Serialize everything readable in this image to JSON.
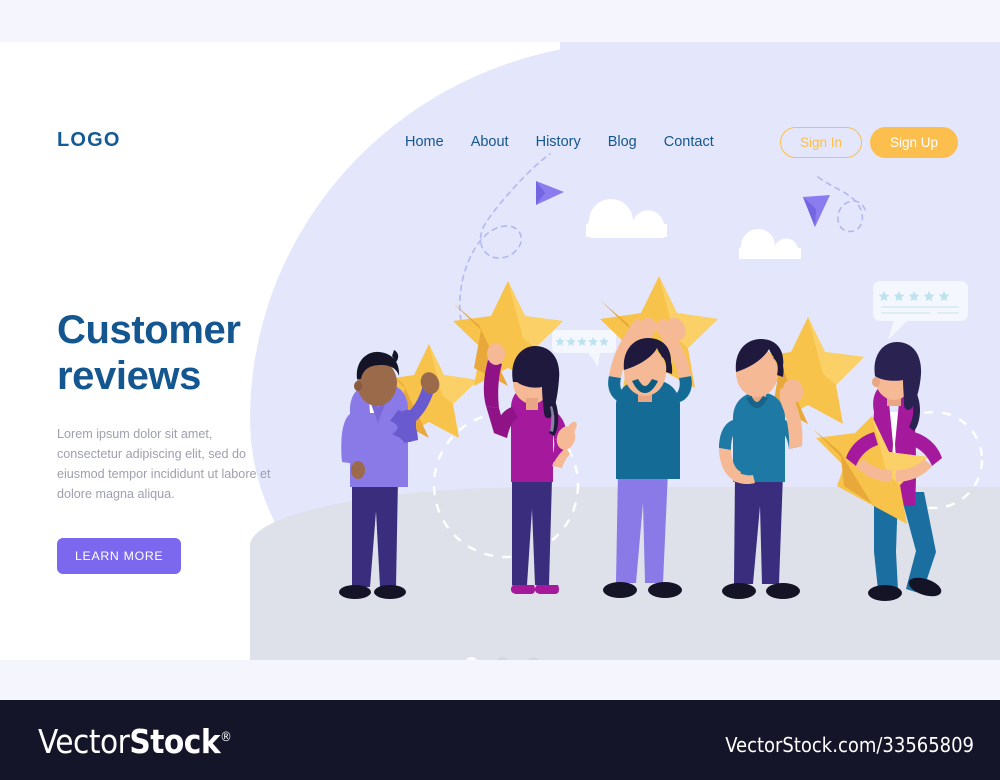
{
  "header": {
    "logo": "LOGO",
    "nav": [
      {
        "label": "Home"
      },
      {
        "label": "About"
      },
      {
        "label": "History"
      },
      {
        "label": "Blog"
      },
      {
        "label": "Contact"
      }
    ],
    "sign_in": "Sign In",
    "sign_up": "Sign Up"
  },
  "hero": {
    "title_line1": "Customer",
    "title_line2": "reviews",
    "subtitle": "Lorem ipsum dolor sit amet, consectetur adipiscing elit, sed do eiusmod tempor incididunt ut labore et dolore magna aliqua.",
    "cta": "LEARN MORE"
  },
  "carousel": {
    "dots": 3,
    "active_index": 0
  },
  "illustration": {
    "people": [
      {
        "name": "man-purple-cardigan",
        "star_count": 1,
        "pose": "holding-star-up"
      },
      {
        "name": "woman-magenta-top",
        "star_count": 1,
        "pose": "raising-star-overhead"
      },
      {
        "name": "man-teal-shirt",
        "star_count": 1,
        "pose": "two-hands-star-overhead"
      },
      {
        "name": "man-blue-tshirt",
        "star_count": 1,
        "pose": "holding-star-side"
      },
      {
        "name": "woman-magenta-coat",
        "star_count": 1,
        "pose": "hugging-star"
      }
    ],
    "review_bubbles": [
      {
        "stars": 5,
        "lines": 0
      },
      {
        "stars": 5,
        "lines": 3
      }
    ],
    "clouds": 2,
    "paper_planes": 2,
    "dashed_circles": 2
  },
  "footer": {
    "brand_thin": "Vector",
    "brand_bold": "Stock",
    "registered": "®",
    "url": "VectorStock.com/33565809"
  },
  "colors": {
    "page_bg": "#f5f5fd",
    "card_bg": "#ffffff",
    "blob": "#e4e7fb",
    "ground": "#dee1ea",
    "brand_blue": "#14568f",
    "accent_yellow": "#fcbf4d",
    "accent_purple": "#7b68ee",
    "star": "#f8c34a",
    "star_shade": "#e9a93a",
    "footer_bg": "#141529",
    "muted_text": "#9ea0ae"
  }
}
